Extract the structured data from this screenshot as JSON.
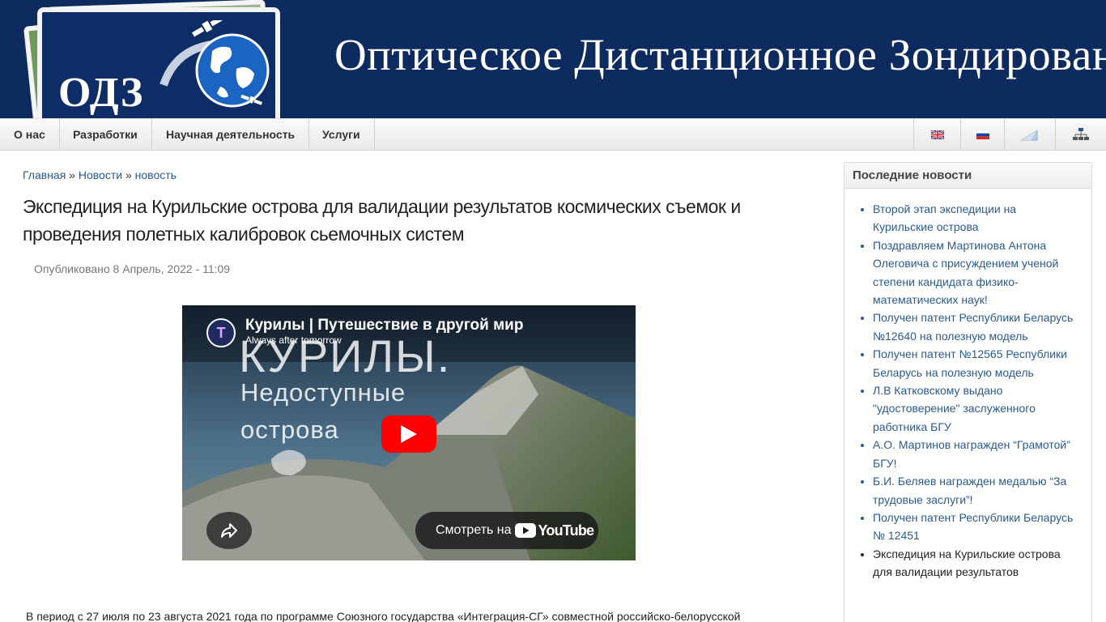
{
  "header": {
    "logo_text": "ОДЗ",
    "site_title": "Оптическое Дистанционное Зондирование"
  },
  "nav": {
    "items": [
      {
        "label": "О нас"
      },
      {
        "label": "Разработки"
      },
      {
        "label": "Научная деятельность"
      },
      {
        "label": "Услуги"
      }
    ],
    "icons": [
      "uk-flag-icon",
      "russia-flag-icon",
      "mail-icon",
      "sitemap-icon"
    ]
  },
  "breadcrumb": {
    "home": "Главная",
    "sep1": " » ",
    "news": "Новости",
    "sep2": " » ",
    "current": "новость"
  },
  "article": {
    "title": "Экспедиция на Курильские острова для валидации результатов космических съемок и проведения полетных калибровок сьемочных систем",
    "submitted": "Опубликовано 8 Апрель, 2022 - 11:09",
    "body_start": "В период с 27 июля по 23 августа 2021 года по программе Союзного государства «Интеграция-СГ» совместной российско-белорусской"
  },
  "video": {
    "title": "Курилы | Путешествие в другой мир",
    "channel": "Always after tomorrow",
    "overlay_line1": "КУРИЛЫ.",
    "overlay_line2": "Недоступные",
    "overlay_line3": "острова",
    "watch_on": "Смотреть на",
    "youtube": "YouTube"
  },
  "sidebar": {
    "title": "Последние новости",
    "items": [
      {
        "label": "Второй этап экспедиции на Курильские острова"
      },
      {
        "label": "Поздравляем Мартинова Антона Олеговича с присуждением ученой степени кандидата физико-математических наук!"
      },
      {
        "label": "Получен патент Республики Беларусь №12640 на полезную модель"
      },
      {
        "label": "Получен патент №12565 Республики Беларусь на полезную модель"
      },
      {
        "label": "Л.В Катковскому выдано \"удостоверение\" заслуженного работника БГУ"
      },
      {
        "label": "А.О. Мартинов награжден “Грамотой” БГУ!"
      },
      {
        "label": "Б.И. Беляев награжден медалью “За трудовые заслуги”!"
      },
      {
        "label": "Получен патент Республики Беларусь № 12451"
      },
      {
        "label": "Экспедиция на Курильские острова для валидации результатов"
      }
    ]
  }
}
